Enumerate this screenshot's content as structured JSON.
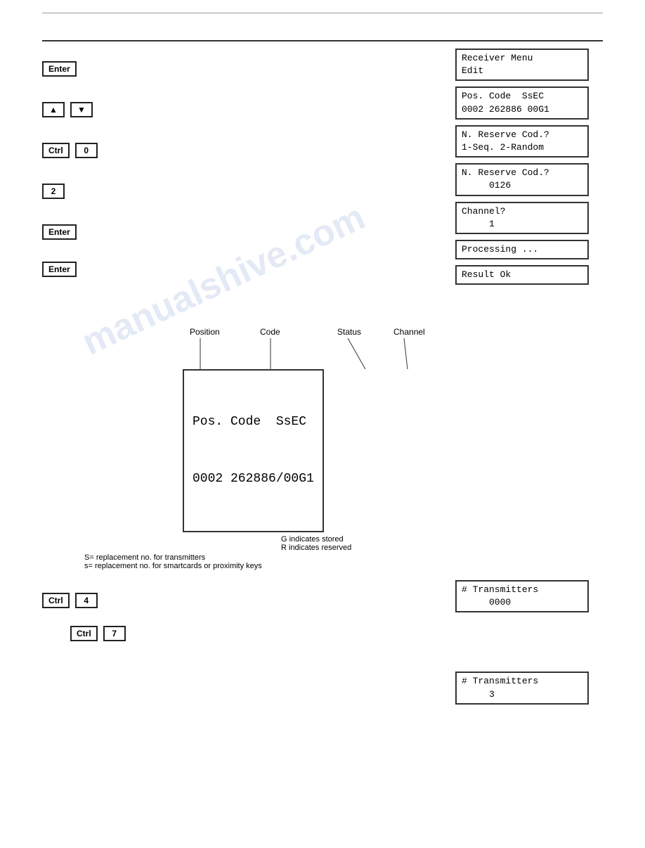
{
  "watermark": "manualshive.com",
  "top_rules": {
    "thin": true,
    "thick": true
  },
  "lcd_boxes": {
    "receiver_menu": "Receiver Menu\nEdit",
    "pos_code_ssec_1": "Pos. Code  SsEC\n0002 262886 00G1",
    "n_reserve_cod_1": "N. Reserve Cod.?\n1-Seq. 2-Random",
    "n_reserve_cod_2": "N. Reserve Cod.?\n     0126",
    "channel": "Channel?\n     1",
    "processing": "Processing ...",
    "result_ok": "Result Ok",
    "transmitters_0000": "# Transmitters\n     0000",
    "transmitters_3": "# Transmitters\n     3"
  },
  "keys": {
    "enter1": "Enter",
    "arrow_up": "▲",
    "arrow_down": "▼",
    "ctrl1": "Ctrl",
    "zero": "0",
    "two": "2",
    "enter2": "Enter",
    "enter3": "Enter",
    "ctrl2": "Ctrl",
    "four": "4",
    "ctrl3": "Ctrl",
    "seven": "7"
  },
  "diagram": {
    "labels": {
      "position": "Position",
      "code": "Code",
      "status": "Status",
      "channel": "Channel"
    },
    "lcd_line1": "Pos. Code  SsEC",
    "lcd_line2": "0002 262886/00G1",
    "notes": {
      "g_stored": "G indicates stored",
      "r_reserved": "R indicates reserved",
      "s_upper": "S= replacement no. for transmitters",
      "s_lower": "s= replacement no. for smartcards or proximity keys"
    }
  }
}
